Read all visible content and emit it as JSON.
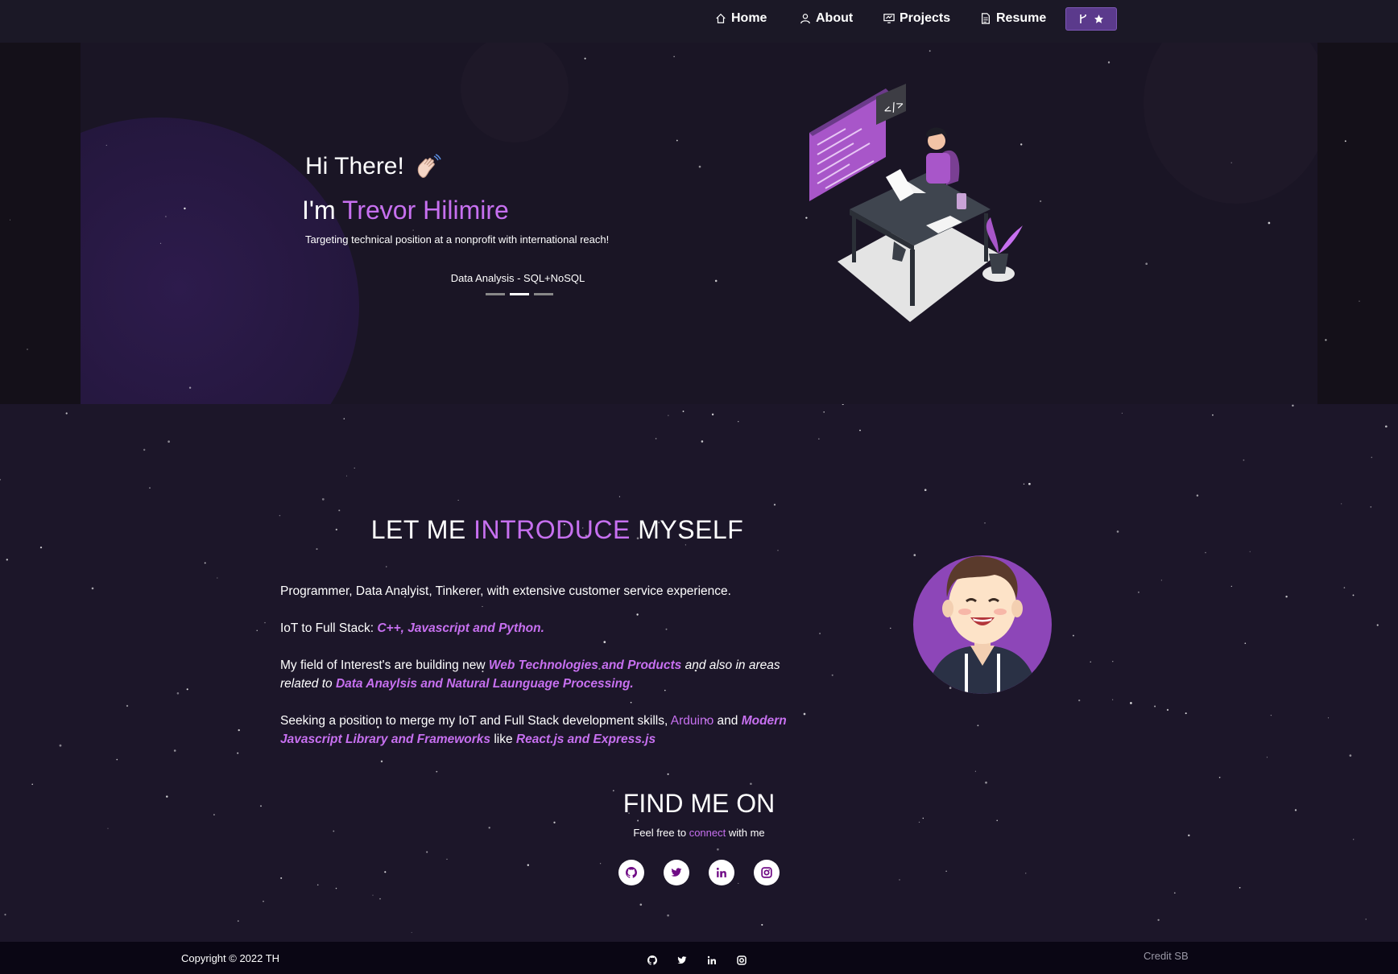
{
  "nav": {
    "items": [
      {
        "label": "Home",
        "icon": "home-icon"
      },
      {
        "label": "About",
        "icon": "user-icon"
      },
      {
        "label": "Projects",
        "icon": "projects-icon"
      },
      {
        "label": "Resume",
        "icon": "document-icon"
      }
    ],
    "fork_icons": [
      "fork-icon",
      "star-icon"
    ]
  },
  "hero": {
    "greeting": "Hi There!",
    "wave_icon": "waving-hand-icon",
    "im": "I'm",
    "name": "Trevor Hilimire",
    "tagline": "Targeting technical position at a nonprofit with international reach!",
    "typed_text": "Data Analysis - SQL+NoSQL",
    "carousel_active_index": 1
  },
  "about": {
    "title_part1": "LET ME",
    "title_accent": "INTRODUCE",
    "title_part2": "MYSELF",
    "p1": "Programmer, Data Analyist, Tinkerer, with extensive customer service experience.",
    "p2_prefix": "IoT to Full Stack: ",
    "p2_highlight": "C++, Javascript and Python.",
    "p3_prefix": "My field of Interest's are building new ",
    "p3_highlight1": "Web Technologies and Products",
    "p3_mid": " and also in areas related to ",
    "p3_highlight2": "Data Anaylsis and Natural Launguage Processing.",
    "p4_prefix": "Seeking a position to merge my IoT and Full Stack development skills, ",
    "p4_arduino": "Arduino",
    "p4_and": " and ",
    "p4_highlight1": "Modern Javascript Library and Frameworks",
    "p4_like": " like ",
    "p4_highlight2": "React.js and Express.js"
  },
  "find": {
    "title": "FIND ME ON",
    "sub_prefix": "Feel free to ",
    "sub_link": "connect",
    "sub_suffix": " with me",
    "socials": [
      "github-icon",
      "twitter-icon",
      "linkedin-icon",
      "instagram-icon"
    ]
  },
  "footer": {
    "copyright": "Copyright © 2022 TH",
    "credit": "Credit SB"
  },
  "colors": {
    "accent": "#c770f0",
    "background": "#1c1629",
    "nav_bg": "#1b1826",
    "footer_bg": "#0a0614",
    "fork_button": "#5b3a8c"
  }
}
